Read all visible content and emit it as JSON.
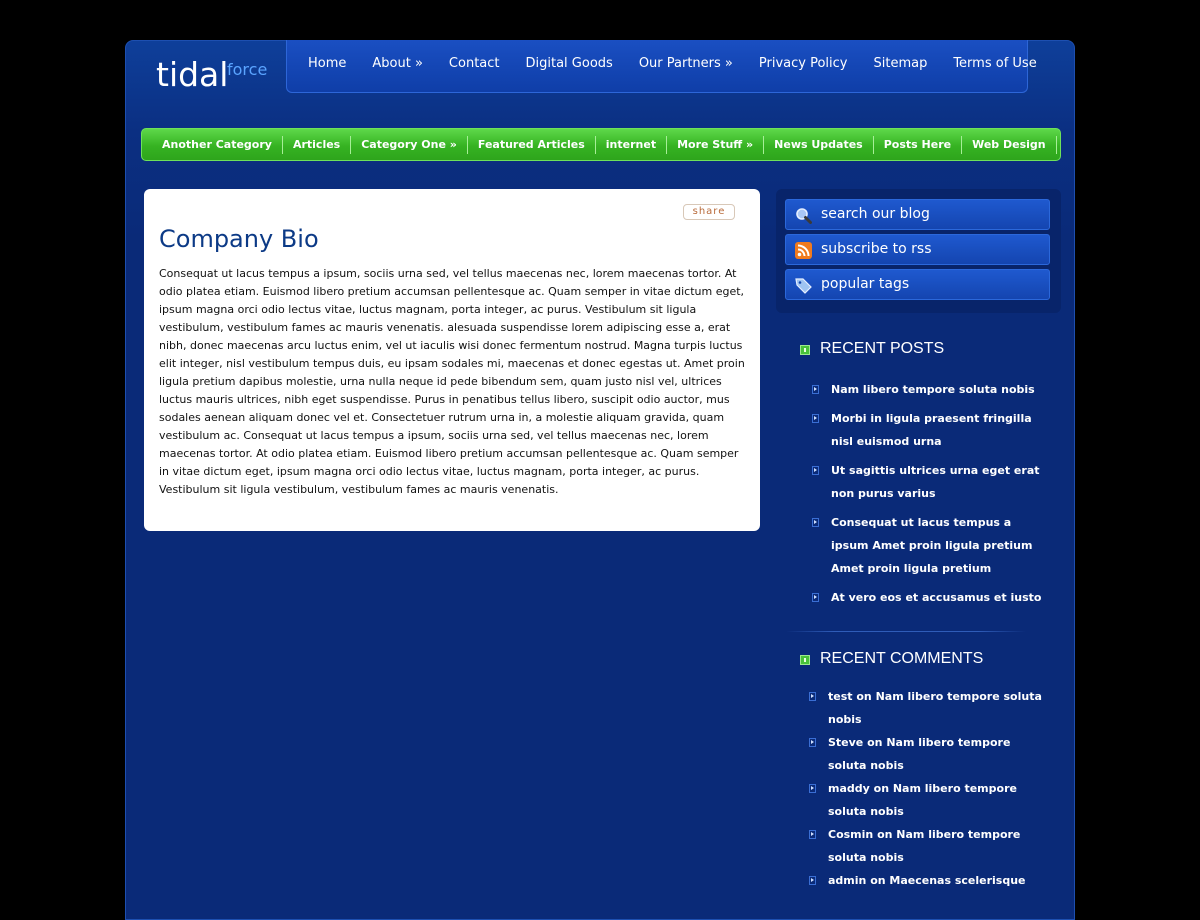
{
  "logo": {
    "main": "tidal",
    "sub": "force"
  },
  "topnav": [
    "Home",
    "About »",
    "Contact",
    "Digital Goods",
    "Our Partners »",
    "Privacy Policy",
    "Sitemap",
    "Terms of Use"
  ],
  "categories": [
    "Another Category",
    "Articles",
    "Category One »",
    "Featured Articles",
    "internet",
    "More Stuff »",
    "News Updates",
    "Posts Here",
    "Web Design"
  ],
  "post": {
    "share_label": "share",
    "title": "Company Bio",
    "body": "Consequat ut lacus tempus a ipsum, sociis urna sed, vel tellus maecenas nec, lorem maecenas tortor. At odio platea etiam. Euismod libero pretium accumsan pellentesque ac. Quam semper in vitae dictum eget, ipsum magna orci odio lectus vitae, luctus magnam, porta integer, ac purus. Vestibulum sit ligula vestibulum, vestibulum fames ac mauris venenatis. alesuada suspendisse lorem adipiscing esse a, erat nibh, donec maecenas arcu luctus enim, vel ut iaculis wisi donec fermentum nostrud. Magna turpis luctus elit integer, nisl vestibulum tempus duis, eu ipsam sodales mi, maecenas et donec egestas ut. Amet proin ligula pretium dapibus molestie, urna nulla neque id pede bibendum sem, quam justo nisl vel, ultrices luctus mauris ultrices, nibh eget suspendisse. Purus in penatibus tellus libero, suscipit odio auctor, mus sodales aenean aliquam donec vel et. Consectetuer rutrum urna in, a molestie aliquam gravida, quam vestibulum ac. Consequat ut lacus tempus a ipsum, sociis urna sed, vel tellus maecenas nec, lorem maecenas tortor. At odio platea etiam. Euismod libero pretium accumsan pellentesque ac. Quam semper in vitae dictum eget, ipsum magna orci odio lectus vitae, luctus magnam, porta integer, ac purus. Vestibulum sit ligula vestibulum, vestibulum fames ac mauris venenatis."
  },
  "sidebar": {
    "search_label": "search our blog",
    "rss_label": "subscribe to rss",
    "tags_label": "popular tags",
    "recent_posts_title": "RECENT POSTS",
    "recent_posts": [
      "Nam libero tempore soluta nobis",
      "Morbi in ligula praesent fringilla nisl euismod urna",
      "Ut sagittis ultrices urna eget erat non purus varius",
      "Consequat ut lacus tempus a ipsum Amet proin ligula pretium Amet proin ligula pretium",
      "At vero eos et accusamus et iusto"
    ],
    "recent_comments_title": "RECENT COMMENTS",
    "recent_comments": [
      "test on Nam libero tempore soluta nobis",
      "Steve on Nam libero tempore soluta nobis",
      "maddy on Nam libero tempore soluta nobis",
      "Cosmin on Nam libero tempore soluta nobis",
      "admin on Maecenas scelerisque"
    ]
  },
  "colors": {
    "background": "#000000",
    "page_blue": "#0a2a78",
    "nav_blue": "#1445b0",
    "category_green": "#36b322",
    "title_blue": "#0c3a86"
  }
}
